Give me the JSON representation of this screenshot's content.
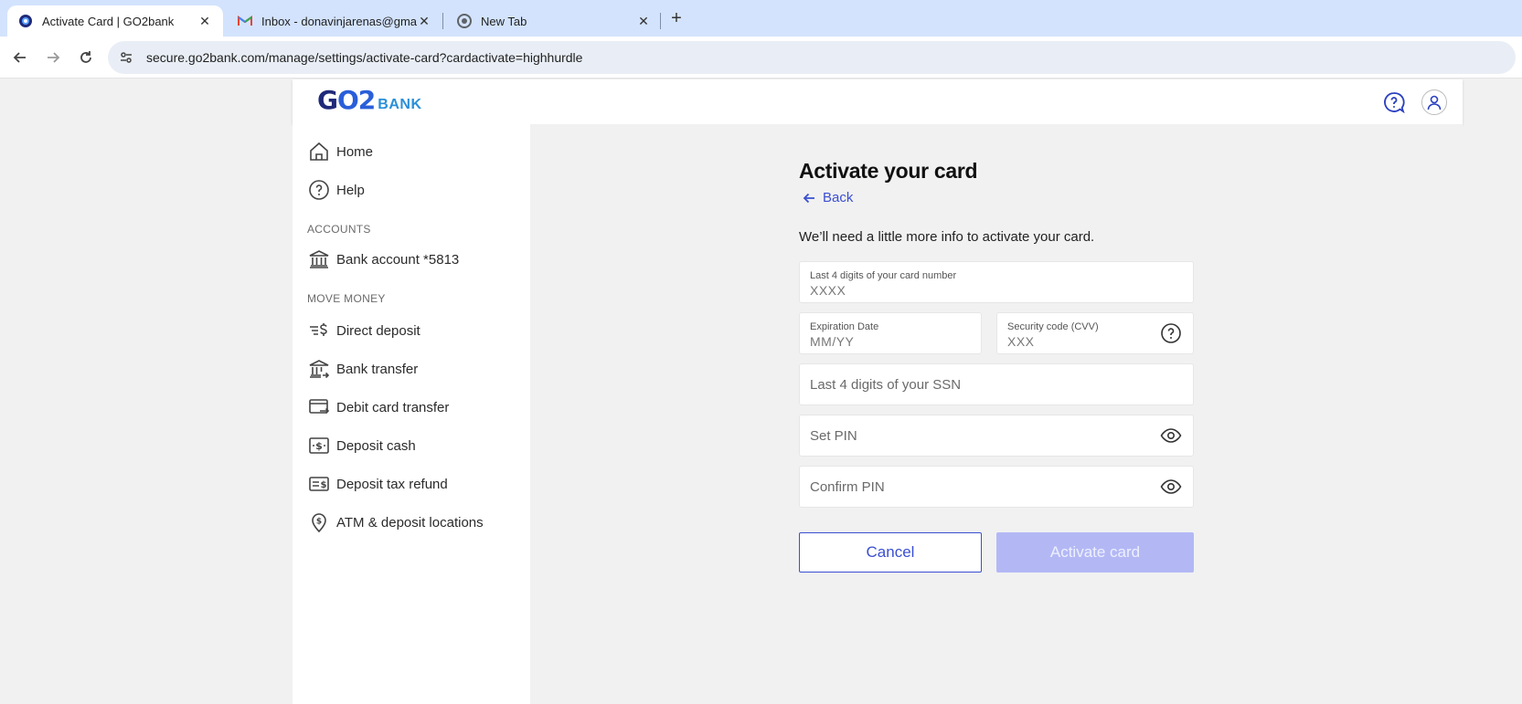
{
  "browser": {
    "tabs": [
      {
        "title": "Activate Card | GO2bank",
        "active": true,
        "favicon": "go2bank-favicon"
      },
      {
        "title": "Inbox - donavinjarenas@gmail.com",
        "active": false,
        "favicon": "gmail-icon"
      },
      {
        "title": "New Tab",
        "active": false,
        "favicon": "chrome-icon"
      }
    ],
    "url": "secure.go2bank.com/manage/settings/activate-card?cardactivate=highhurdle"
  },
  "header": {
    "logo_main": "GO2",
    "logo_sub": "BANK",
    "help_icon": "question-circle-icon",
    "profile_icon": "user-icon"
  },
  "sidebar": {
    "top_items": [
      {
        "label": "Home",
        "icon": "home-icon"
      },
      {
        "label": "Help",
        "icon": "help-icon"
      }
    ],
    "accounts_title": "ACCOUNTS",
    "accounts_items": [
      {
        "label": "Bank account *5813",
        "icon": "bank-icon"
      }
    ],
    "move_money_title": "MOVE MONEY",
    "move_money_items": [
      {
        "label": "Direct deposit",
        "icon": "direct-deposit-icon"
      },
      {
        "label": "Bank transfer",
        "icon": "bank-transfer-icon"
      },
      {
        "label": "Debit card transfer",
        "icon": "debit-card-transfer-icon"
      },
      {
        "label": "Deposit cash",
        "icon": "deposit-cash-icon"
      },
      {
        "label": "Deposit tax refund",
        "icon": "tax-refund-icon"
      },
      {
        "label": "ATM & deposit locations",
        "icon": "location-pin-icon"
      }
    ]
  },
  "form": {
    "title": "Activate your card",
    "back_label": "Back",
    "subtitle": "We’ll need a little more info to activate your card.",
    "card_last4": {
      "label": "Last 4 digits of your card number",
      "placeholder": "XXXX"
    },
    "expiration": {
      "label": "Expiration Date",
      "placeholder": "MM/YY"
    },
    "cvv": {
      "label": "Security code (CVV)",
      "placeholder": "XXX"
    },
    "ssn_last4": {
      "placeholder": "Last 4 digits of your SSN"
    },
    "set_pin": {
      "placeholder": "Set PIN"
    },
    "confirm_pin": {
      "placeholder": "Confirm PIN"
    },
    "cancel_label": "Cancel",
    "activate_label": "Activate card"
  },
  "colors": {
    "brand_blue": "#3a4fd1",
    "logo_navy": "#1f2a7a",
    "disabled_button": "#b3b8f5",
    "tabstrip": "#d3e3fd"
  }
}
